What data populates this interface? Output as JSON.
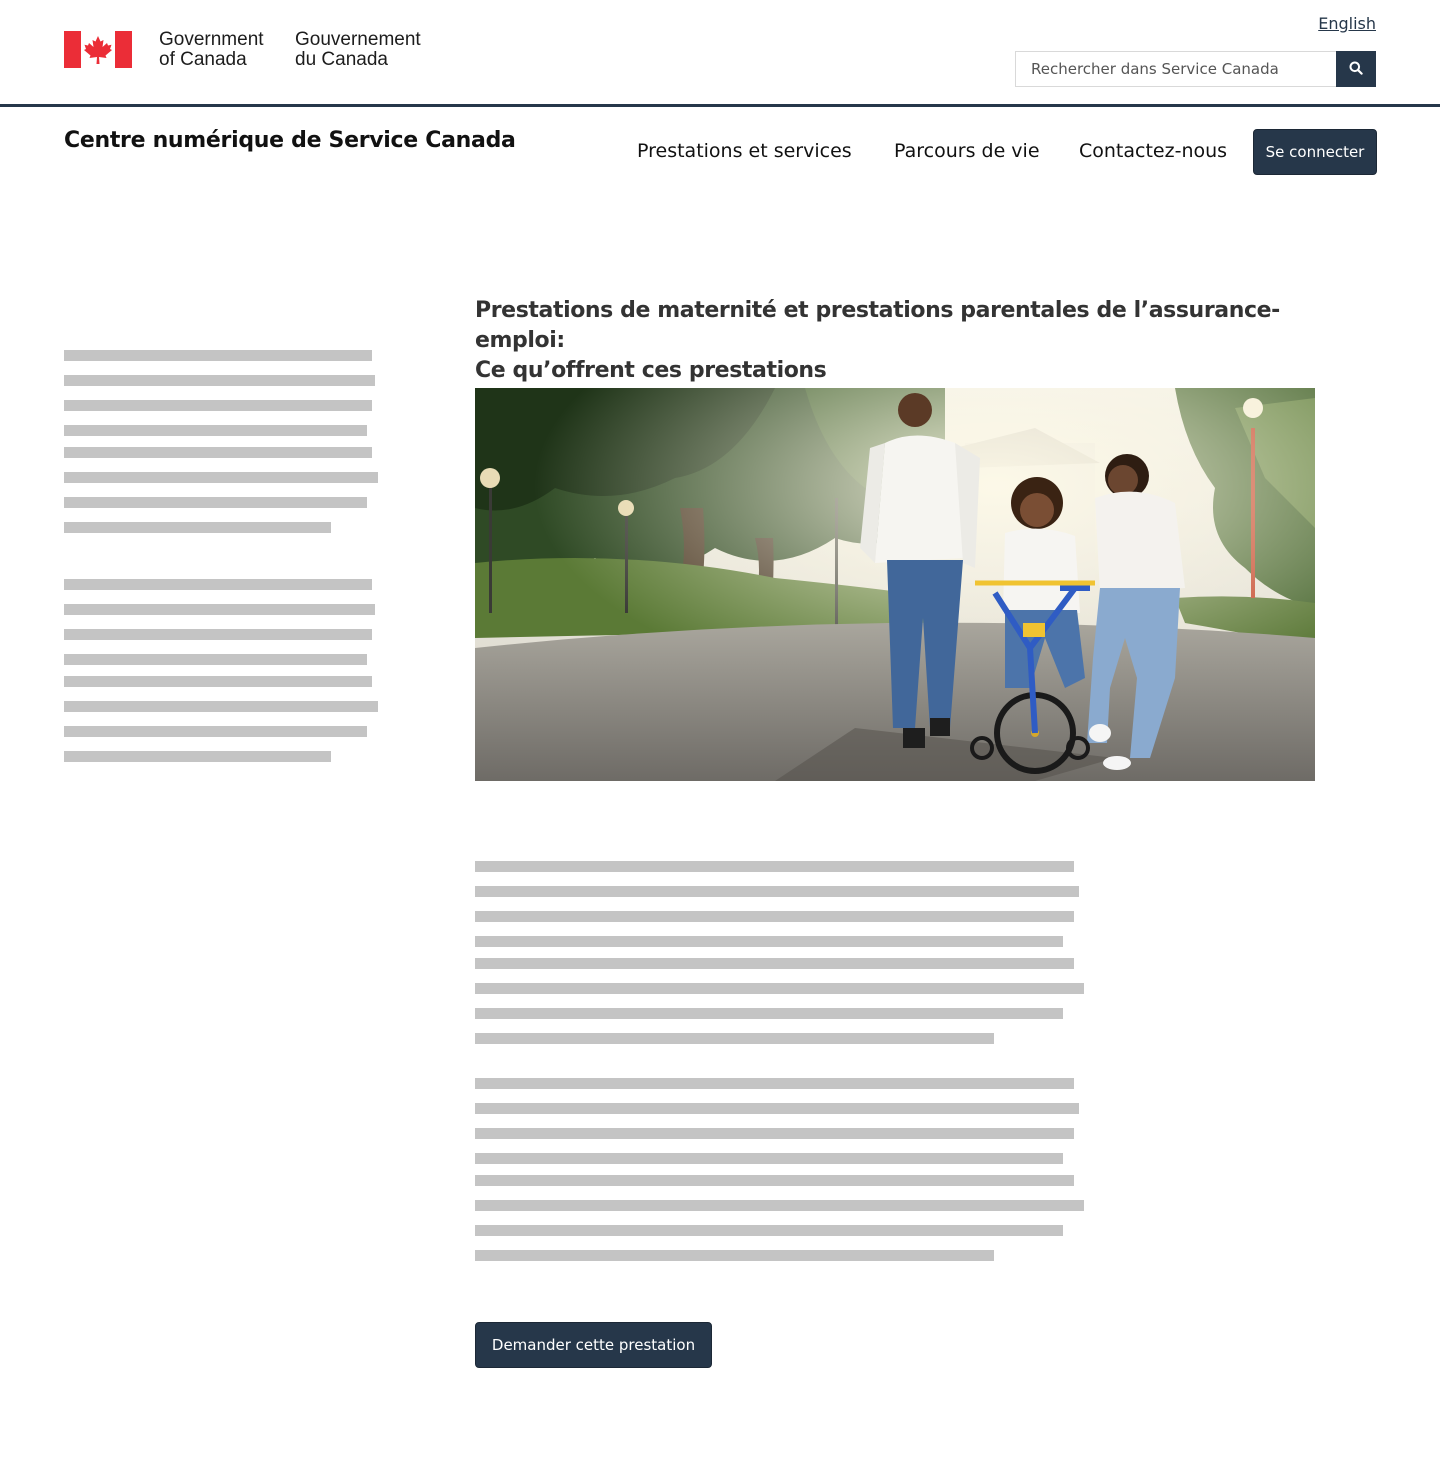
{
  "header": {
    "gov_name_en": "Government\nof Canada",
    "gov_name_fr": "Gouvernement\ndu Canada",
    "language_link": "English",
    "search": {
      "placeholder": "Rechercher dans Service Canada",
      "value": ""
    }
  },
  "site": {
    "title": "Centre numérique de Service Canada"
  },
  "nav": {
    "items": [
      {
        "label": "Prestations et services"
      },
      {
        "label": "Parcours de vie"
      },
      {
        "label": "Contactez-nous"
      }
    ],
    "signin_label": "Se connecter"
  },
  "main": {
    "title_line1": "Prestations de maternité et prestations parentales de l’assurance-emploi:",
    "title_line2": "Ce qu’offrent ces prestations",
    "apply_label": "Demander cette prestation"
  },
  "colors": {
    "brand_dark": "#26374a",
    "flag_red": "#eb2d37",
    "placeholder_gray": "#c4c4c4"
  },
  "icons": {
    "search": "magnifier-icon",
    "flag": "canada-flag-icon"
  }
}
